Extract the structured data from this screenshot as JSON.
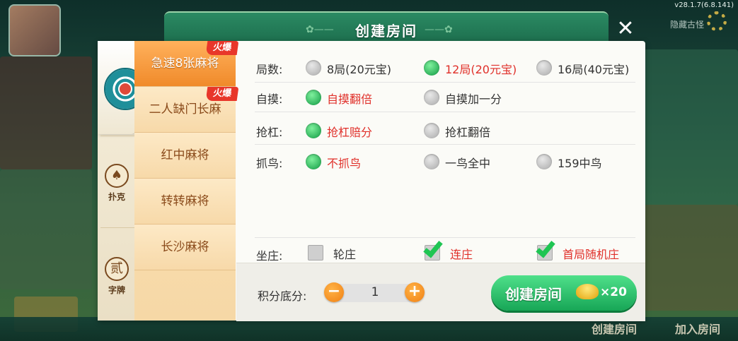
{
  "version": "v28.1.7(6.8.141)",
  "background": {
    "settings_text": "隐藏古怪",
    "bottom_labels": [
      "创建房间",
      "加入房间"
    ]
  },
  "dialog": {
    "title": "创建房间",
    "close_icon": "close-icon"
  },
  "categories": [
    {
      "icon": "mahjong-icon",
      "label": ""
    },
    {
      "icon": "spade-icon",
      "label": "扑克",
      "glyph": "♠"
    },
    {
      "icon": "word-tile-icon",
      "label": "字牌",
      "glyph": "贰"
    }
  ],
  "tabs": [
    {
      "label": "急速8张麻将",
      "hot": "火爆",
      "active": true
    },
    {
      "label": "二人缺门长麻",
      "hot": "火爆",
      "active": false
    },
    {
      "label": "红中麻将",
      "hot": "",
      "active": false
    },
    {
      "label": "转转麻将",
      "hot": "",
      "active": false
    },
    {
      "label": "长沙麻将",
      "hot": "",
      "active": false
    }
  ],
  "options": {
    "rounds": {
      "label": "局数:",
      "choices": [
        "8局(20元宝)",
        "12局(20元宝)",
        "16局(40元宝)"
      ],
      "selected": 1
    },
    "self_draw": {
      "label": "自摸:",
      "choices": [
        "自摸翻倍",
        "自摸加一分"
      ],
      "selected": 0
    },
    "rob_kong": {
      "label": "抢杠:",
      "choices": [
        "抢杠赔分",
        "抢杠翻倍"
      ],
      "selected": 0
    },
    "birds": {
      "label": "抓鸟:",
      "choices": [
        "不抓鸟",
        "一鸟全中",
        "159中鸟"
      ],
      "selected": 0
    },
    "dealer": {
      "label": "坐庄:",
      "choices": [
        "轮庄",
        "连庄",
        "首局随机庄"
      ],
      "checked": [
        false,
        true,
        true
      ]
    }
  },
  "score": {
    "label": "积分底分:",
    "value": "1",
    "minus": "−",
    "plus": "+"
  },
  "create": {
    "label": "创建房间",
    "cost": "×20",
    "icon": "gold-ingot-icon"
  },
  "colors": {
    "accent_green": "#17a656",
    "selected_red": "#e0302a",
    "tab_orange": "#f08a2a",
    "hot_red": "#e8362a"
  }
}
